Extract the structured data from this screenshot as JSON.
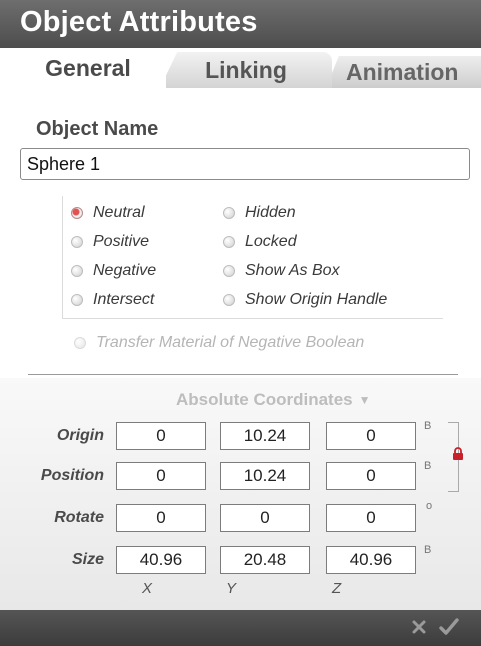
{
  "window": {
    "title": "Object Attributes"
  },
  "tabs": [
    {
      "label": "General"
    },
    {
      "label": "Linking"
    },
    {
      "label": "Animation"
    }
  ],
  "object_name": {
    "label": "Object Name",
    "value": "Sphere 1"
  },
  "mode_options": [
    {
      "label": "Neutral",
      "selected": true
    },
    {
      "label": "Positive",
      "selected": false
    },
    {
      "label": "Negative",
      "selected": false
    },
    {
      "label": "Intersect",
      "selected": false
    }
  ],
  "flag_options": [
    {
      "label": "Hidden",
      "selected": false
    },
    {
      "label": "Locked",
      "selected": false
    },
    {
      "label": "Show As Box",
      "selected": false
    },
    {
      "label": "Show Origin Handle",
      "selected": false
    }
  ],
  "transfer_option": {
    "label": "Transfer Material of Negative Boolean",
    "enabled": false
  },
  "coordinates": {
    "mode": "Absolute Coordinates",
    "rows": [
      {
        "label": "Origin",
        "values": [
          "0",
          "10.24",
          "0"
        ],
        "unit": "B"
      },
      {
        "label": "Position",
        "values": [
          "0",
          "10.24",
          "0"
        ],
        "unit": "B"
      },
      {
        "label": "Rotate",
        "values": [
          "0",
          "0",
          "0"
        ],
        "unit": "o"
      },
      {
        "label": "Size",
        "values": [
          "40.96",
          "20.48",
          "40.96"
        ],
        "unit": "B"
      }
    ],
    "axes": [
      "X",
      "Y",
      "Z"
    ]
  },
  "icons": {
    "lock": "lock-icon",
    "dropdown": "chevron-down-icon",
    "cancel": "close-icon",
    "confirm": "checkmark-icon"
  },
  "colors": {
    "accent": "#e35252",
    "header": "#5a5a5a",
    "disabled_text": "#b5b5b5"
  }
}
